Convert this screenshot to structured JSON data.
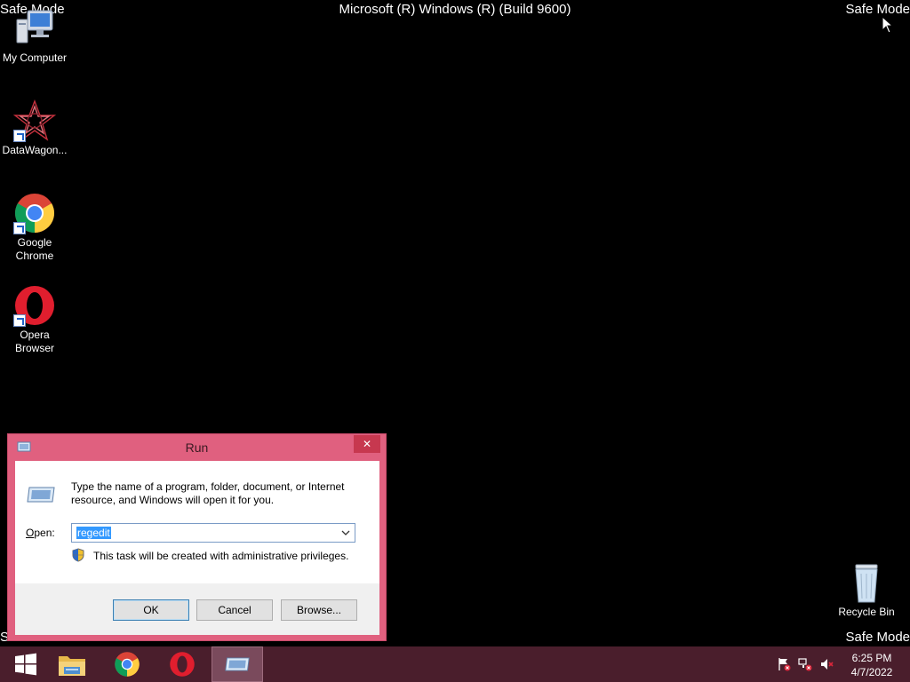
{
  "overlay": {
    "safe_mode_label": "Safe Mode",
    "build_title": "Microsoft (R) Windows (R) (Build 9600)"
  },
  "desktop_icons": [
    {
      "label": "My Computer",
      "icon": "computer-icon"
    },
    {
      "label": "DataWagon...",
      "icon": "datawagon-icon"
    },
    {
      "label": "Google Chrome",
      "icon": "chrome-icon"
    },
    {
      "label": "Opera Browser",
      "icon": "opera-icon"
    },
    {
      "label": "Recycle Bin",
      "icon": "recycle-bin-icon"
    }
  ],
  "run_dialog": {
    "title": "Run",
    "close_glyph": "✕",
    "description": "Type the name of a program, folder, document, or Internet resource, and Windows will open it for you.",
    "open_label_accel": "O",
    "open_label_rest": "pen:",
    "open_value": "regedit",
    "admin_note": "This task will be created with administrative privileges.",
    "ok_label": "OK",
    "cancel_label": "Cancel",
    "browse_label": "Browse..."
  },
  "taskbar": {
    "items": [
      "start-icon",
      "file-explorer-icon",
      "chrome-icon",
      "opera-icon",
      "run-icon"
    ],
    "active_item": "run-icon",
    "clock_time": "6:25 PM",
    "clock_date": "4/7/2022",
    "tray_icons": [
      "action-center-flag-icon",
      "network-icon",
      "volume-muted-icon"
    ]
  },
  "colors": {
    "dialog_frame": "#e0607f",
    "taskbar": "#4a1e2c",
    "selection": "#3399ff"
  }
}
